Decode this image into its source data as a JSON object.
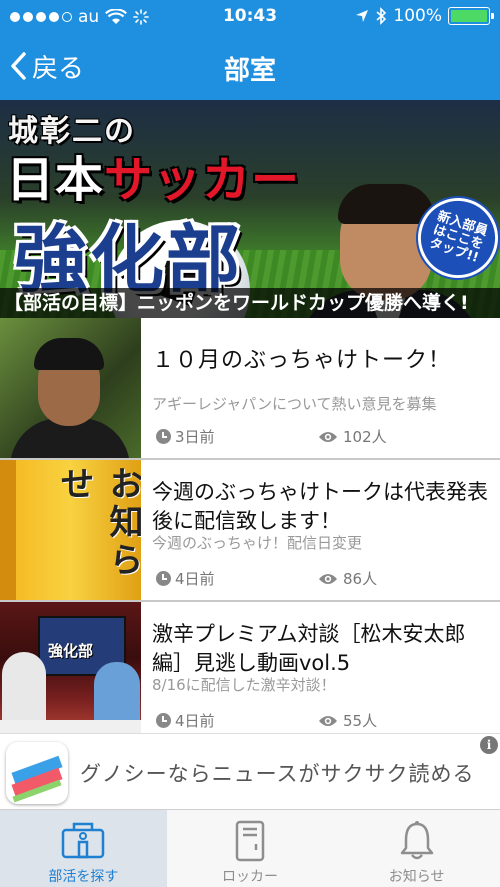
{
  "status_bar": {
    "carrier": "au",
    "time": "10:43",
    "battery": "100%",
    "battery_level": 1.0,
    "signal_bars": 4
  },
  "nav": {
    "back_label": "戻る",
    "title": "部室"
  },
  "banner": {
    "name": "城彰二の",
    "title_part1": "日本",
    "title_part2": "サッカー",
    "title_part3": "強化部",
    "badge": "新入部員はここをタップ!!",
    "goal": "【部活の目標】ニッポンをワールドカップ優勝へ導く!"
  },
  "items": [
    {
      "title": "１０月のぶっちゃけトーク！",
      "description": "アギーレジャパンについて熱い意見を募集",
      "time": "3日前",
      "views": "102人",
      "thumbnail": "person-photo"
    },
    {
      "title": "今週のぶっちゃけトークは代表発表後に配信致します！",
      "description": "今週のぶっちゃけ！配信日変更",
      "time": "4日前",
      "views": "86人",
      "thumbnail": "notice",
      "thumbnail_text": "お知らせ"
    },
    {
      "title": "激辛プレミアム対談［松木安太郎編］見逃し動画vol.5",
      "description": "8/16に配信した激辛対談！",
      "time": "4日前",
      "views": "55人",
      "thumbnail": "talk-show",
      "thumbnail_text": "強化部"
    }
  ],
  "ad": {
    "text": "グノシーならニュースがサクサク読める",
    "info_label": "i"
  },
  "tabs": [
    {
      "label": "部活を探す",
      "icon": "clubhouse-icon",
      "active": true
    },
    {
      "label": "ロッカー",
      "icon": "locker-icon",
      "active": false
    },
    {
      "label": "お知らせ",
      "icon": "bell-icon",
      "active": false
    }
  ],
  "colors": {
    "nav_background": "#1f8fe0",
    "active_tab": "#1f7fd0",
    "battery": "#4cd964"
  }
}
